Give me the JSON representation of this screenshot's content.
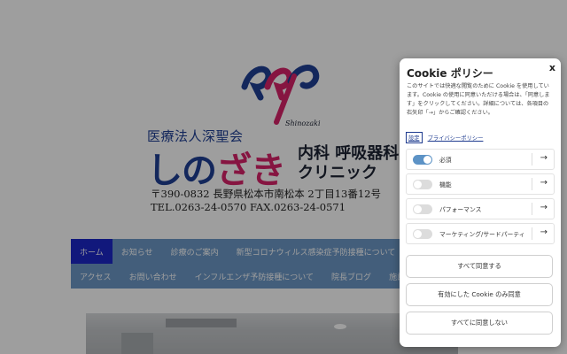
{
  "site": {
    "org_name": "医療法人深聖会",
    "logo_caption": "Shinozaki",
    "clinic_name_a": "しの",
    "clinic_name_b": "ざき",
    "dept_line1": "内科 呼吸器科",
    "dept_line2": "クリニック",
    "address": "〒390-0832 長野県松本市南松本 2丁目13番12号",
    "tel_fax": "TEL.0263-24-0570 FAX.0263-24-0571",
    "nav_row1": [
      "ホーム",
      "お知らせ",
      "診療のご案内",
      "新型コロナウィルス感染症予防接種について"
    ],
    "nav_row2": [
      "アクセス",
      "お問い合わせ",
      "インフルエンザ予防接種について",
      "院長ブログ",
      "施設"
    ],
    "colors": {
      "nav": "#6d98c7",
      "nav_active": "#1c27c9",
      "brand_blue": "#1f3f95",
      "brand_pink": "#d9226a"
    }
  },
  "cookie": {
    "title": "Cookie ポリシー",
    "close": "x",
    "description": "このサイトでは快適な閲覧のために Cookie を使用しています。Cookie の使用に同意いただける場合は、「同意します」をクリックしてください。詳細については、各項目の右矢印「→」からご確認ください。",
    "link_settings": "設定",
    "link_privacy": "プライバシーポリシー",
    "categories": [
      {
        "label": "必須",
        "enabled": true
      },
      {
        "label": "機能",
        "enabled": false
      },
      {
        "label": "パフォーマンス",
        "enabled": false
      },
      {
        "label": "マーケティング/サードパーティ",
        "enabled": false
      }
    ],
    "arrow_icon": "arrow-right-icon",
    "buttons": {
      "accept_all": "すべて同意する",
      "accept_enabled": "有効にした Cookie のみ同意",
      "reject_all": "すべてに同意しない"
    },
    "colors": {
      "toggle_on": "#5d93c6",
      "link": "#1e3b8f"
    }
  }
}
